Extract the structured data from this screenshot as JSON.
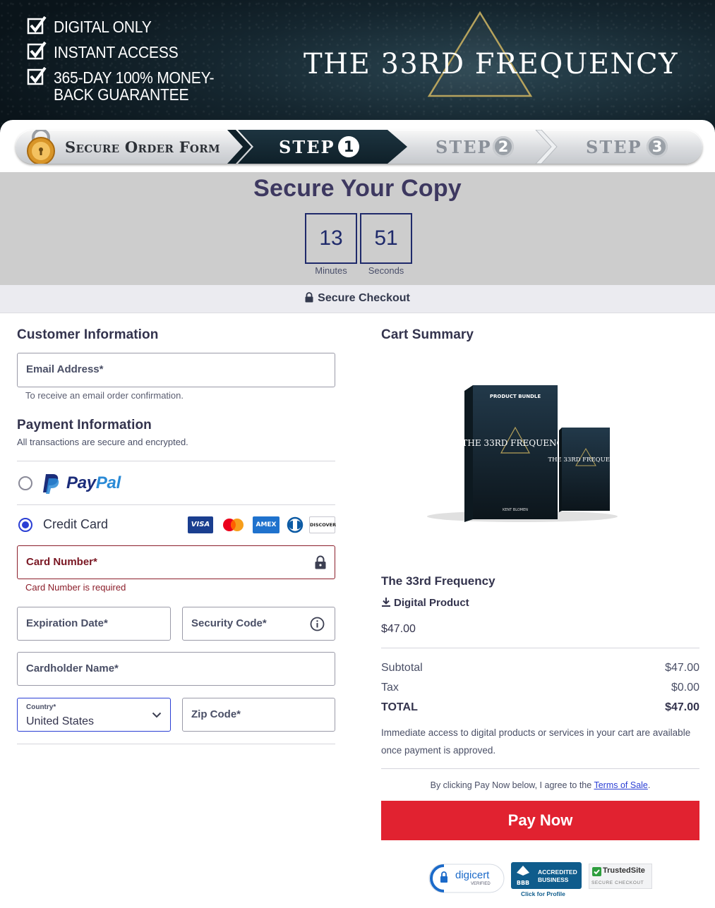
{
  "banner": {
    "checklist": [
      "DIGITAL ONLY",
      "INSTANT ACCESS",
      "365-DAY 100% MONEY-BACK GUARANTEE"
    ],
    "brand": "THE 33RD FREQUENCY"
  },
  "stepbar": {
    "secure_label": "Secure Order Form",
    "steps": [
      {
        "label": "STEP",
        "num": "1"
      },
      {
        "label": "STEP",
        "num": "2"
      },
      {
        "label": "STEP",
        "num": "3"
      }
    ],
    "active_step": 1
  },
  "timer": {
    "title": "Secure Your Copy",
    "minutes": "13",
    "seconds": "51",
    "minutes_label": "Minutes",
    "seconds_label": "Seconds"
  },
  "secure_checkout": "Secure Checkout",
  "customer": {
    "heading": "Customer Information",
    "email_label": "Email Address*",
    "email_helper": "To receive an email order confirmation."
  },
  "payment": {
    "heading": "Payment Information",
    "subheading": "All transactions are secure and encrypted.",
    "paypal_a": "Pay",
    "paypal_b": "Pal",
    "credit_card_label": "Credit Card",
    "selected": "credit-card",
    "card_brands": [
      "VISA",
      "mastercard",
      "AMEX",
      "diners",
      "DISCOVER"
    ],
    "card_number_label": "Card Number*",
    "card_number_error": "Card Number is required",
    "expiration_label": "Expiration Date*",
    "security_code_label": "Security Code*",
    "cardholder_label": "Cardholder Name*",
    "country_label": "Country*",
    "country_value": "United States",
    "zip_label": "Zip Code*"
  },
  "cart": {
    "heading": "Cart Summary",
    "product_name": "The 33rd Frequency",
    "product_type": "Digital Product",
    "product_price": "$47.00",
    "subtotal_label": "Subtotal",
    "subtotal_value": "$47.00",
    "tax_label": "Tax",
    "tax_value": "$0.00",
    "total_label": "TOTAL",
    "total_value": "$47.00",
    "note": "Immediate access to digital products or services in your cart are available once payment is approved.",
    "agree_prefix": "By clicking Pay Now below, I agree to the",
    "terms_link": "Terms of Sale",
    "agree_suffix": ".",
    "pay_button": "Pay Now",
    "image_box": {
      "top": "PRODUCT BUNDLE",
      "title": "THE 33RD FREQUENCY",
      "author": "KENT BLOMEN"
    }
  },
  "badges": {
    "digicert": "digicert",
    "digicert_sub": "VERIFIED",
    "bbb_top": "ACCREDITED",
    "bbb_bottom": "BUSINESS",
    "bbb_logo": "BBB",
    "bbb_link": "Click for Profile",
    "trusted": "TrustedSite",
    "trusted_sub": "SECURE CHECKOUT"
  },
  "colors": {
    "accent": "#2b3fd4",
    "error": "#8b1e2a",
    "pay_button": "#e12230",
    "timer_border": "#1f2a6b",
    "header_dark": "#0f2029"
  }
}
